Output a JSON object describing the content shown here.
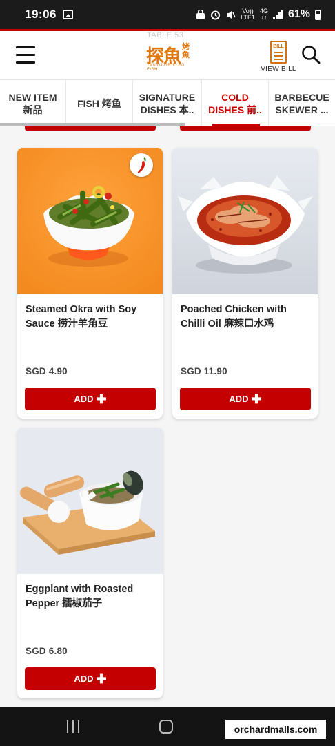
{
  "status_bar": {
    "time": "19:06",
    "volte": "Vo))",
    "lte": "LTE1",
    "network": "4G",
    "battery": "61%"
  },
  "header": {
    "table": "TABLE 53",
    "logo_main": "探魚",
    "logo_side": "烤魚",
    "logo_sub": "TANYU GRILLED FISH",
    "bill_doc": "BILL",
    "view_bill": "VIEW BILL"
  },
  "tabs": [
    {
      "label": "NEW ITEM\n新品"
    },
    {
      "label": "FISH 烤鱼"
    },
    {
      "label": "SIGNATURE\nDISHES 本.."
    },
    {
      "label": "COLD\nDISHES 前.."
    },
    {
      "label": "BARBECUE\nSKEWER ..."
    }
  ],
  "active_tab": 3,
  "items": [
    {
      "name": "Steamed Okra with Soy Sauce 捞汁羊角豆",
      "price": "SGD 4.90",
      "add": "ADD",
      "spicy": true
    },
    {
      "name": "Poached Chicken with Chilli Oil 麻辣口水鸡",
      "price": "SGD 11.90",
      "add": "ADD",
      "spicy": false
    },
    {
      "name": "Eggplant with Roasted Pepper 擂椒茄子",
      "price": "SGD 6.80",
      "add": "ADD",
      "spicy": false
    }
  ],
  "watermark": "orchardmalls.com",
  "colors": {
    "brand_red": "#c40000",
    "logo_orange": "#e07a10",
    "okra_bg": "#f7922a"
  }
}
